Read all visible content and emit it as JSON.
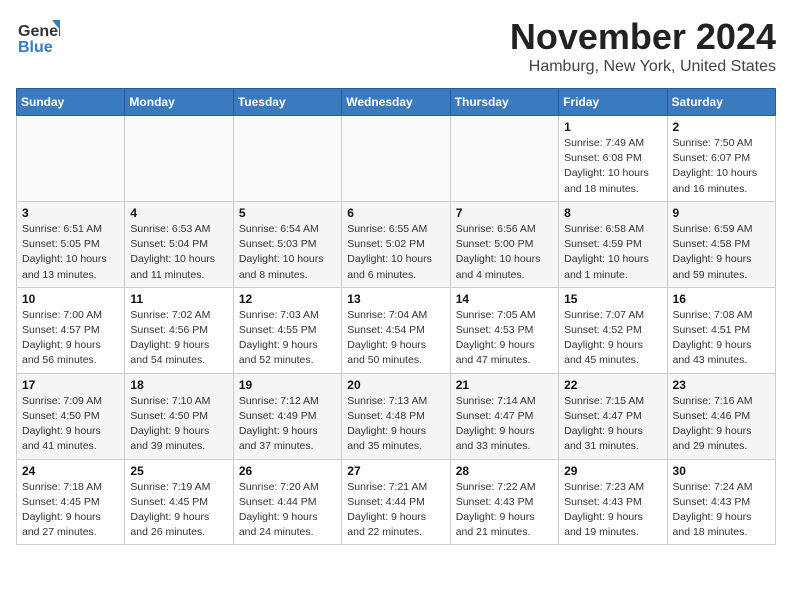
{
  "header": {
    "logo_general": "General",
    "logo_blue": "Blue",
    "month": "November 2024",
    "location": "Hamburg, New York, United States"
  },
  "weekdays": [
    "Sunday",
    "Monday",
    "Tuesday",
    "Wednesday",
    "Thursday",
    "Friday",
    "Saturday"
  ],
  "weeks": [
    [
      {
        "day": "",
        "info": ""
      },
      {
        "day": "",
        "info": ""
      },
      {
        "day": "",
        "info": ""
      },
      {
        "day": "",
        "info": ""
      },
      {
        "day": "",
        "info": ""
      },
      {
        "day": "1",
        "info": "Sunrise: 7:49 AM\nSunset: 6:08 PM\nDaylight: 10 hours\nand 18 minutes."
      },
      {
        "day": "2",
        "info": "Sunrise: 7:50 AM\nSunset: 6:07 PM\nDaylight: 10 hours\nand 16 minutes."
      }
    ],
    [
      {
        "day": "3",
        "info": "Sunrise: 6:51 AM\nSunset: 5:05 PM\nDaylight: 10 hours\nand 13 minutes."
      },
      {
        "day": "4",
        "info": "Sunrise: 6:53 AM\nSunset: 5:04 PM\nDaylight: 10 hours\nand 11 minutes."
      },
      {
        "day": "5",
        "info": "Sunrise: 6:54 AM\nSunset: 5:03 PM\nDaylight: 10 hours\nand 8 minutes."
      },
      {
        "day": "6",
        "info": "Sunrise: 6:55 AM\nSunset: 5:02 PM\nDaylight: 10 hours\nand 6 minutes."
      },
      {
        "day": "7",
        "info": "Sunrise: 6:56 AM\nSunset: 5:00 PM\nDaylight: 10 hours\nand 4 minutes."
      },
      {
        "day": "8",
        "info": "Sunrise: 6:58 AM\nSunset: 4:59 PM\nDaylight: 10 hours\nand 1 minute."
      },
      {
        "day": "9",
        "info": "Sunrise: 6:59 AM\nSunset: 4:58 PM\nDaylight: 9 hours\nand 59 minutes."
      }
    ],
    [
      {
        "day": "10",
        "info": "Sunrise: 7:00 AM\nSunset: 4:57 PM\nDaylight: 9 hours\nand 56 minutes."
      },
      {
        "day": "11",
        "info": "Sunrise: 7:02 AM\nSunset: 4:56 PM\nDaylight: 9 hours\nand 54 minutes."
      },
      {
        "day": "12",
        "info": "Sunrise: 7:03 AM\nSunset: 4:55 PM\nDaylight: 9 hours\nand 52 minutes."
      },
      {
        "day": "13",
        "info": "Sunrise: 7:04 AM\nSunset: 4:54 PM\nDaylight: 9 hours\nand 50 minutes."
      },
      {
        "day": "14",
        "info": "Sunrise: 7:05 AM\nSunset: 4:53 PM\nDaylight: 9 hours\nand 47 minutes."
      },
      {
        "day": "15",
        "info": "Sunrise: 7:07 AM\nSunset: 4:52 PM\nDaylight: 9 hours\nand 45 minutes."
      },
      {
        "day": "16",
        "info": "Sunrise: 7:08 AM\nSunset: 4:51 PM\nDaylight: 9 hours\nand 43 minutes."
      }
    ],
    [
      {
        "day": "17",
        "info": "Sunrise: 7:09 AM\nSunset: 4:50 PM\nDaylight: 9 hours\nand 41 minutes."
      },
      {
        "day": "18",
        "info": "Sunrise: 7:10 AM\nSunset: 4:50 PM\nDaylight: 9 hours\nand 39 minutes."
      },
      {
        "day": "19",
        "info": "Sunrise: 7:12 AM\nSunset: 4:49 PM\nDaylight: 9 hours\nand 37 minutes."
      },
      {
        "day": "20",
        "info": "Sunrise: 7:13 AM\nSunset: 4:48 PM\nDaylight: 9 hours\nand 35 minutes."
      },
      {
        "day": "21",
        "info": "Sunrise: 7:14 AM\nSunset: 4:47 PM\nDaylight: 9 hours\nand 33 minutes."
      },
      {
        "day": "22",
        "info": "Sunrise: 7:15 AM\nSunset: 4:47 PM\nDaylight: 9 hours\nand 31 minutes."
      },
      {
        "day": "23",
        "info": "Sunrise: 7:16 AM\nSunset: 4:46 PM\nDaylight: 9 hours\nand 29 minutes."
      }
    ],
    [
      {
        "day": "24",
        "info": "Sunrise: 7:18 AM\nSunset: 4:45 PM\nDaylight: 9 hours\nand 27 minutes."
      },
      {
        "day": "25",
        "info": "Sunrise: 7:19 AM\nSunset: 4:45 PM\nDaylight: 9 hours\nand 26 minutes."
      },
      {
        "day": "26",
        "info": "Sunrise: 7:20 AM\nSunset: 4:44 PM\nDaylight: 9 hours\nand 24 minutes."
      },
      {
        "day": "27",
        "info": "Sunrise: 7:21 AM\nSunset: 4:44 PM\nDaylight: 9 hours\nand 22 minutes."
      },
      {
        "day": "28",
        "info": "Sunrise: 7:22 AM\nSunset: 4:43 PM\nDaylight: 9 hours\nand 21 minutes."
      },
      {
        "day": "29",
        "info": "Sunrise: 7:23 AM\nSunset: 4:43 PM\nDaylight: 9 hours\nand 19 minutes."
      },
      {
        "day": "30",
        "info": "Sunrise: 7:24 AM\nSunset: 4:43 PM\nDaylight: 9 hours\nand 18 minutes."
      }
    ]
  ]
}
